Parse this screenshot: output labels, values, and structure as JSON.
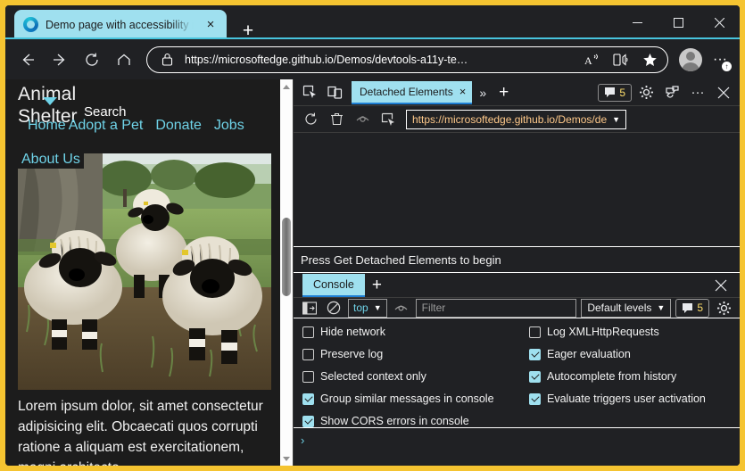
{
  "browser": {
    "tab": {
      "title": "Demo page with accessibility issues",
      "favicon": "edge-logo-icon",
      "close_label": "×"
    },
    "new_tab_label": "+",
    "window_controls": {
      "minimize": "minimize-icon",
      "maximize": "maximize-icon",
      "close": "close-icon"
    },
    "nav": {
      "back": "back-arrow-icon",
      "forward": "forward-arrow-icon",
      "reload": "reload-icon",
      "home": "home-icon",
      "lock": "lock-icon",
      "url": "https://microsoftedge.github.io/Demos/devtools-a11y-te…",
      "read_aloud": "read-aloud-icon",
      "split_screen": "split-screen-icon",
      "favorite": "star-icon",
      "profile": "avatar-icon",
      "settings_more": "···",
      "settings_badge": "↑"
    }
  },
  "page": {
    "site_title_line1": "Animal",
    "site_title_line2": "Shelter",
    "search_label": "Search",
    "nav_links": [
      {
        "label": "Home"
      },
      {
        "label": "Adopt a Pet"
      },
      {
        "label": "Donate"
      },
      {
        "label": "Jobs"
      }
    ],
    "dropdown_item": "About Us",
    "hero_image_alt": "three-valais-blacknose-sheep-photo",
    "body_text": "Lorem ipsum dolor, sit amet consectetur adipisicing elit. Obcaecati quos corrupti ratione a aliquam est exercitationem, magni architecto",
    "scrollbar": {
      "up": "scroll-up-arrow-icon",
      "down": "scroll-down-arrow-icon"
    }
  },
  "devtools": {
    "toolbar": {
      "inspect": "inspect-element-icon",
      "device_toolbar": "device-toolbar-icon",
      "more_tabs": "»",
      "add_tab": "+",
      "issues_count": "5",
      "issues_icon": "issues-speech-bubble-icon",
      "settings": "gear-icon",
      "customize": "customize-devtools-icon",
      "more": "···",
      "close": "×"
    },
    "tabs": [
      {
        "label": "Detached Elements",
        "close": "×",
        "active": true
      }
    ],
    "panel_toolbar": {
      "refresh": "refresh-icon",
      "delete": "trash-icon",
      "visibility": "eye-icon",
      "target": "target-frame-icon",
      "url_value": "https://microsoftedge.github.io/Demos/de",
      "url_caret": "▼"
    },
    "status_message": "Press Get Detached Elements to begin",
    "drawer": {
      "tabs": [
        {
          "label": "Console",
          "active": true
        }
      ],
      "add_tab": "+",
      "close": "×",
      "toolbar": {
        "sidebar_toggle": "console-sidebar-icon",
        "clear": "clear-console-icon",
        "context_value": "top",
        "context_caret": "▼",
        "eye": "live-expression-eye-icon",
        "filter_placeholder": "Filter",
        "levels_value": "Default levels",
        "levels_caret": "▼",
        "issues_count": "5",
        "issues_icon": "issues-speech-bubble-icon",
        "settings": "gear-icon"
      },
      "settings_left": [
        {
          "label": "Hide network",
          "checked": false
        },
        {
          "label": "Preserve log",
          "checked": false
        },
        {
          "label": "Selected context only",
          "checked": false
        },
        {
          "label": "Group similar messages in console",
          "checked": true
        },
        {
          "label": "Show CORS errors in console",
          "checked": true
        }
      ],
      "settings_right": [
        {
          "label": "Log XMLHttpRequests",
          "checked": false
        },
        {
          "label": "Eager evaluation",
          "checked": true
        },
        {
          "label": "Autocomplete from history",
          "checked": true
        },
        {
          "label": "Evaluate triggers user activation",
          "checked": true
        }
      ],
      "prompt_symbol": "›"
    }
  },
  "colors": {
    "window_border": "#f5c431",
    "accent_cyan": "#9fe0ef",
    "link_cyan": "#6fd3e8",
    "devtools_bg": "#202124",
    "page_bg": "#1c1c1c",
    "badge_number": "#ffdf6c",
    "active_tab_underline": "#1e7fd4"
  }
}
